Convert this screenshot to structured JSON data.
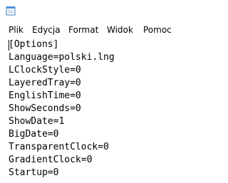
{
  "window": {
    "icon": "notepad-icon"
  },
  "menu": {
    "items": [
      "Plik",
      "Edycja",
      "Format",
      "Widok",
      "Pomoc"
    ]
  },
  "editor": {
    "lines": [
      "[Options]",
      "Language=polski.lng",
      "LClockStyle=0",
      "LayeredTray=0",
      "EnglishTime=0",
      "ShowSeconds=0",
      "ShowDate=1",
      "BigDate=0",
      "TransparentClock=0",
      "GradientClock=0",
      "Startup=0"
    ]
  }
}
